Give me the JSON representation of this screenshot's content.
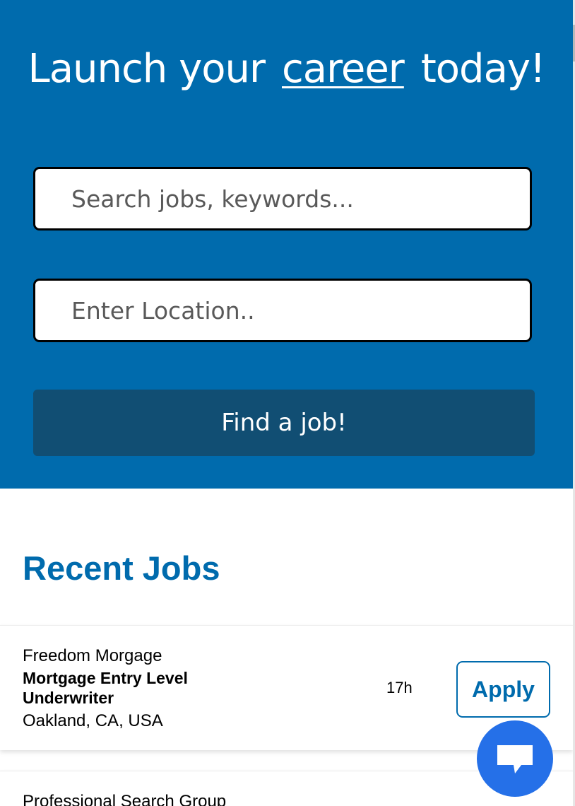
{
  "hero": {
    "headline_before": "Launch your",
    "headline_accent": "career",
    "headline_after": "today!",
    "keywords_placeholder": "Search jobs, keywords...",
    "location_placeholder": "Enter Location..",
    "find_button_label": "Find a job!"
  },
  "recent_jobs": {
    "title": "Recent Jobs",
    "jobs": [
      {
        "company": "Freedom Morgage",
        "title": "Mortgage Entry Level Underwriter",
        "location": "Oakland, CA, USA",
        "age": "17h",
        "apply_label": "Apply"
      },
      {
        "company": "Professional Search Group"
      }
    ]
  },
  "chat": {
    "icon": "chat-bubble-icon"
  },
  "colors": {
    "brand_blue": "#006bad",
    "button_dark_blue": "#114e73",
    "chat_blue": "#2570e8"
  }
}
